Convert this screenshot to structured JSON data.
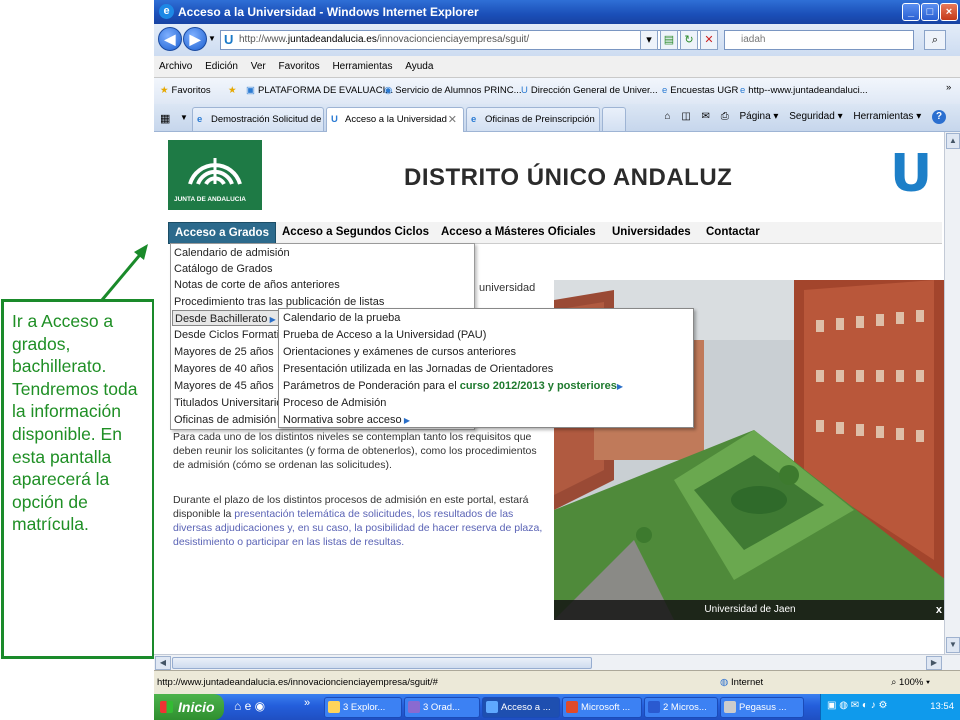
{
  "window": {
    "title": "Acceso a la Universidad - Windows Internet Explorer",
    "controls": [
      "_",
      "□",
      "×"
    ]
  },
  "address_bar": {
    "url_prefix": "http://www.",
    "url_domain": "juntadeandalucia.es",
    "url_path": "/innovacioncienciayempresa/sguit/",
    "search_placeholder": "iadah"
  },
  "menu_bar": [
    "Archivo",
    "Edición",
    "Ver",
    "Favoritos",
    "Herramientas",
    "Ayuda"
  ],
  "favorites_bar": {
    "label": "Favoritos",
    "items": [
      "PLATAFORMA DE EVALUACI...",
      "Servicio de Alumnos PRINC...",
      "Dirección General de Univer...",
      "Encuestas UGR",
      "http--www.juntadeandaluci..."
    ]
  },
  "tabs": [
    {
      "label": "Demostración Solicitud de A...",
      "active": false
    },
    {
      "label": "Acceso a la Universidad",
      "active": true
    },
    {
      "label": "Oficinas de Preinscripción",
      "active": false
    }
  ],
  "command_bar": [
    "Página ▾",
    "Seguridad ▾",
    "Herramientas ▾",
    "?"
  ],
  "site": {
    "logo_text": "JUNTA DE ANDALUCIA",
    "title": "DISTRITO ÚNICO ANDALUZ",
    "nav": [
      "Acceso a Grados",
      "Acceso a Segundos Ciclos",
      "Acceso a Másteres Oficiales",
      "Universidades",
      "Contactar"
    ],
    "behind_word": "universidad",
    "dropdown_main": [
      "Calendario de admisión",
      "Catálogo de Grados",
      "Notas de corte de años anteriores",
      "Procedimiento tras las publicación de listas",
      "Desde Bachillerato",
      "Desde Ciclos Formativos",
      "Mayores de 25 años",
      "Mayores de 40 años",
      "Mayores de 45 años",
      "Titulados Universitarios",
      "Oficinas de admisión"
    ],
    "dropdown_sub": [
      "Calendario de la prueba",
      "Prueba de Acceso a la Universidad (PAU)",
      "Orientaciones y exámenes de cursos anteriores",
      "Presentación utilizada en las Jornadas de Orientadores",
      "Parámetros de Ponderación para el ",
      "Proceso de Admisión",
      "Normativa sobre acceso"
    ],
    "dropdown_sub_highlight": "curso 2012/2013 y posteriores",
    "para1": "Para cada uno de los distintos niveles se contemplan tanto los requisitos que deben reunir los solicitantes (y forma de obtenerlos), como los procedimientos de admisión (cómo se ordenan las solicitudes).",
    "para2_a": "Durante el plazo de los distintos procesos de admisión en este portal, estará disponible la ",
    "para2_link": "presentación telemática de solicitudes, los resultados de las diversas adjudicaciones y, en su caso, la posibilidad de hacer reserva de plaza, desistimiento o participar en las listas de resultas.",
    "photo_caption": "Universidad de Jaen",
    "photo_close": "x"
  },
  "status_bar": {
    "url": "http://www.juntadeandalucia.es/innovacioncienciayempresa/sguit/#",
    "zone": "Internet",
    "zoom": "100%"
  },
  "taskbar": {
    "start": "Inicio",
    "buttons": [
      "3 Explor...",
      "3 Orad...",
      "Acceso a ...",
      "Microsoft ...",
      "2 Micros...",
      "Pegasus ..."
    ],
    "clock": "13:54"
  },
  "annotation": "Ir a Acceso a grados, bachillerato. Tendremos toda la información disponible. En esta pantalla aparecerá la opción de matrícula.",
  "colors": {
    "annotation_green": "#1f8f25",
    "nav_selected": "#2c6a8c",
    "link_color": "#5a63b5",
    "ie_blue": "#1b4fb8"
  }
}
